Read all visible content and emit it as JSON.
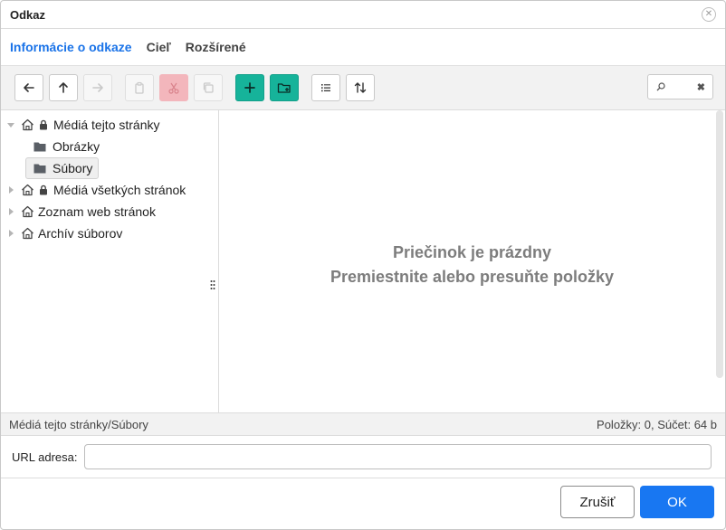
{
  "window": {
    "title": "Odkaz",
    "close_icon": "close-icon"
  },
  "tabs": [
    {
      "label": "Informácie o odkaze",
      "active": true
    },
    {
      "label": "Cieľ",
      "active": false
    },
    {
      "label": "Rozšírené",
      "active": false
    }
  ],
  "toolbar": {
    "buttons": [
      {
        "icon": "arrow-left-icon",
        "enabled": true
      },
      {
        "icon": "arrow-up-icon",
        "enabled": true
      },
      {
        "icon": "arrow-right-icon",
        "enabled": false
      },
      {
        "icon": "paste-icon",
        "enabled": false
      },
      {
        "icon": "cut-icon",
        "enabled": false
      },
      {
        "icon": "copy-icon",
        "enabled": false
      },
      {
        "icon": "plus-icon",
        "enabled": true
      },
      {
        "icon": "new-folder-icon",
        "enabled": true
      },
      {
        "icon": "list-view-icon",
        "enabled": true
      },
      {
        "icon": "sort-icon",
        "enabled": true
      }
    ],
    "search": {
      "icon": "search-icon",
      "clear_icon": "clear-icon",
      "value": ""
    }
  },
  "tree": [
    {
      "label": "Médiá tejto stránky",
      "icon": "home-icon",
      "locked": true,
      "expanded": true
    },
    {
      "label": "Obrázky",
      "icon": "folder-icon"
    },
    {
      "label": "Súbory",
      "icon": "folder-icon",
      "selected": true
    },
    {
      "label": "Médiá všetkých stránok",
      "icon": "home-icon",
      "locked": true,
      "expanded": false
    },
    {
      "label": "Zoznam web stránok",
      "icon": "home-icon",
      "expanded": false
    },
    {
      "label": "Archív súborov",
      "icon": "home-icon",
      "expanded": false
    }
  ],
  "pane": {
    "empty_line1": "Priečinok je prázdny",
    "empty_line2": "Premiestnite alebo presuňte položky"
  },
  "status": {
    "path": "Médiá tejto stránky/Súbory",
    "summary": "Položky: 0, Súčet: 64 b"
  },
  "url": {
    "label": "URL adresa:",
    "value": ""
  },
  "footer": {
    "cancel_label": "Zrušiť",
    "ok_label": "OK"
  },
  "colors": {
    "accent": "#1877f2",
    "tab_active": "#1a73e8",
    "green_button": "#16b39a",
    "cut_button": "#f3b6bc"
  }
}
